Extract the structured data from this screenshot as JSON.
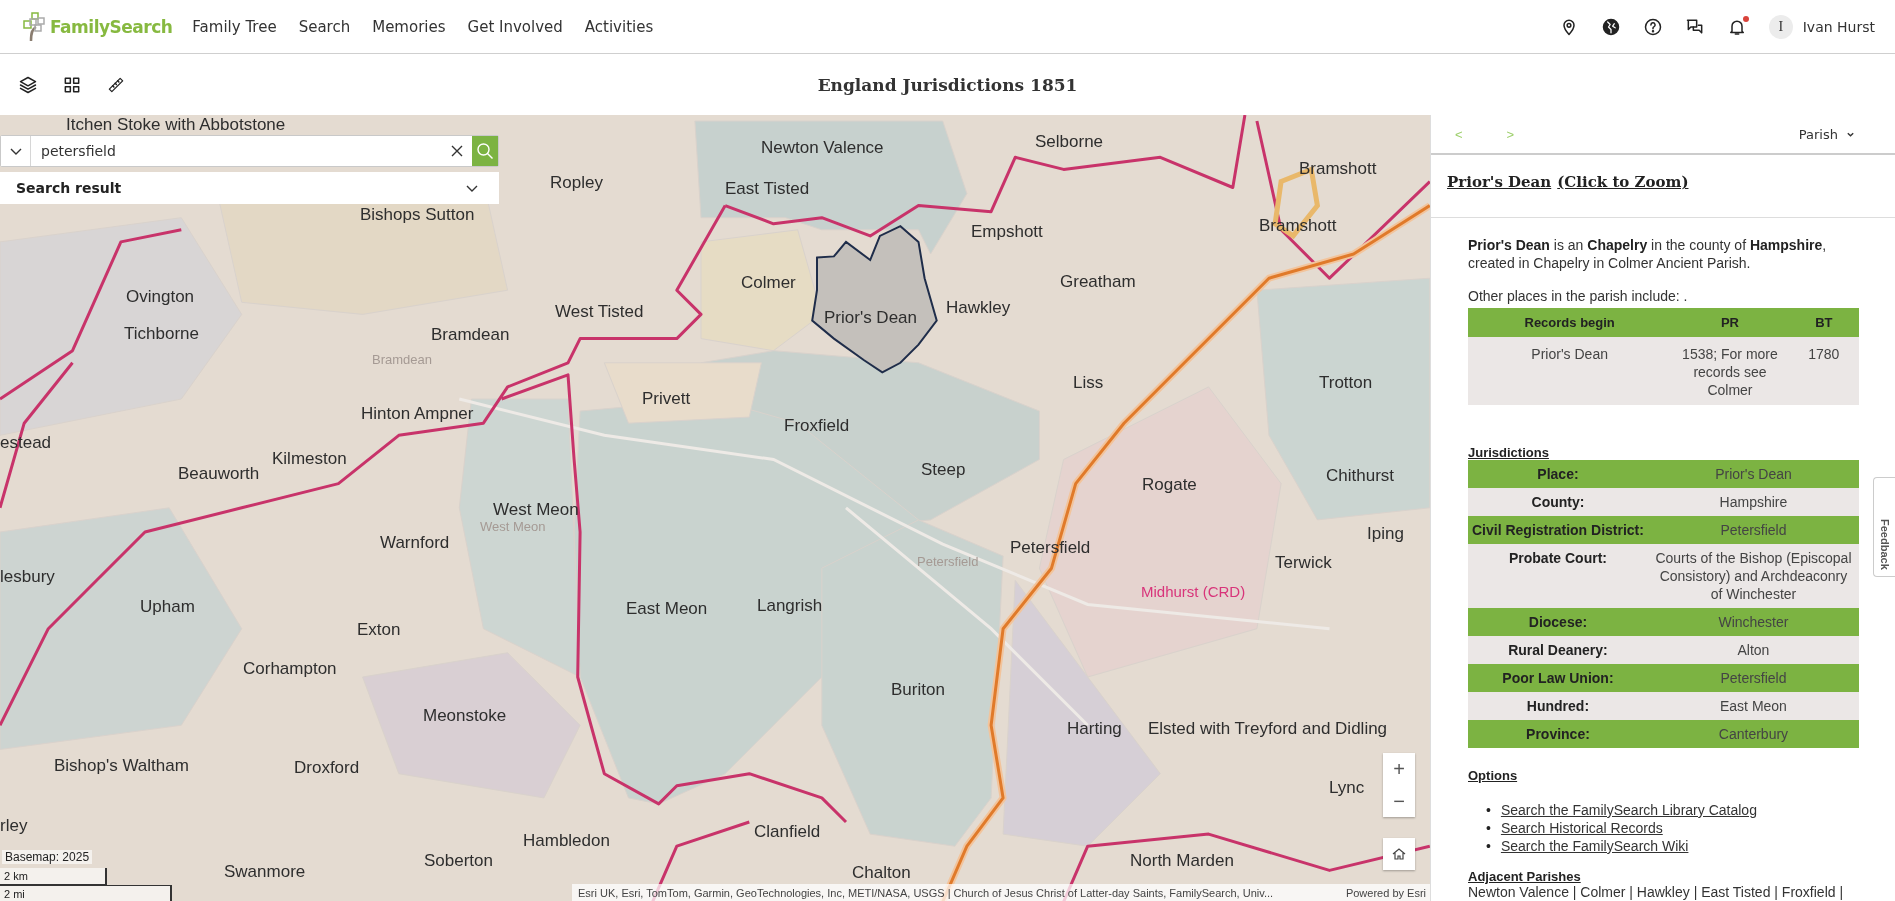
{
  "header": {
    "brand": "FamilySearch",
    "nav": [
      "Family Tree",
      "Search",
      "Memories",
      "Get Involved",
      "Activities"
    ],
    "notifications_unread": true,
    "user": {
      "initial": "I",
      "name": "Ivan Hurst"
    }
  },
  "toolbar": {
    "title": "England Jurisdictions 1851"
  },
  "search": {
    "value": "petersfield",
    "result_label": "Search result"
  },
  "map": {
    "labels": [
      {
        "text": "Itchen Stoke with Abbotstone",
        "kind": "place"
      },
      {
        "text": "Newton Valence",
        "kind": "place"
      },
      {
        "text": "Selborne",
        "kind": "place"
      },
      {
        "text": "Bramshott",
        "kind": "place"
      },
      {
        "text": "Ropley",
        "kind": "place"
      },
      {
        "text": "East Tisted",
        "kind": "place"
      },
      {
        "text": "Bishops Sutton",
        "kind": "place"
      },
      {
        "text": "Empshott",
        "kind": "place"
      },
      {
        "text": "Bramshott",
        "kind": "place"
      },
      {
        "text": "Colmer",
        "kind": "place"
      },
      {
        "text": "Greatham",
        "kind": "place"
      },
      {
        "text": "Ovington",
        "kind": "place"
      },
      {
        "text": "West Tisted",
        "kind": "place"
      },
      {
        "text": "Hawkley",
        "kind": "place"
      },
      {
        "text": "Prior's Dean",
        "kind": "place"
      },
      {
        "text": "Tichborne",
        "kind": "place"
      },
      {
        "text": "Bramdean",
        "kind": "place"
      },
      {
        "text": "Bramdean",
        "kind": "town"
      },
      {
        "text": "Liss",
        "kind": "place"
      },
      {
        "text": "Trotton",
        "kind": "place"
      },
      {
        "text": "Privett",
        "kind": "place"
      },
      {
        "text": "Hinton Ampner",
        "kind": "place"
      },
      {
        "text": "Froxfield",
        "kind": "place"
      },
      {
        "text": "estead",
        "kind": "place"
      },
      {
        "text": "Beauworth",
        "kind": "place"
      },
      {
        "text": "Kilmeston",
        "kind": "place"
      },
      {
        "text": "Steep",
        "kind": "place"
      },
      {
        "text": "Rogate",
        "kind": "place"
      },
      {
        "text": "Chithurst",
        "kind": "place"
      },
      {
        "text": "West Meon",
        "kind": "place"
      },
      {
        "text": "West Meon",
        "kind": "town"
      },
      {
        "text": "Warnford",
        "kind": "place"
      },
      {
        "text": "Petersfield",
        "kind": "place"
      },
      {
        "text": "Iping",
        "kind": "place"
      },
      {
        "text": "lesbury",
        "kind": "place"
      },
      {
        "text": "Petersfield",
        "kind": "town"
      },
      {
        "text": "Terwick",
        "kind": "place"
      },
      {
        "text": "Midhurst (CRD)",
        "kind": "district"
      },
      {
        "text": "Upham",
        "kind": "place"
      },
      {
        "text": "East Meon",
        "kind": "place"
      },
      {
        "text": "Langrish",
        "kind": "place"
      },
      {
        "text": "Exton",
        "kind": "place"
      },
      {
        "text": "Corhampton",
        "kind": "place"
      },
      {
        "text": "Buriton",
        "kind": "place"
      },
      {
        "text": "Meonstoke",
        "kind": "place"
      },
      {
        "text": "Harting",
        "kind": "place"
      },
      {
        "text": "Elsted with Treyford and Didling",
        "kind": "place"
      },
      {
        "text": "Bishop's Waltham",
        "kind": "place"
      },
      {
        "text": "Droxford",
        "kind": "place"
      },
      {
        "text": "Lync",
        "kind": "place"
      },
      {
        "text": "rley",
        "kind": "place"
      },
      {
        "text": "Hambledon",
        "kind": "place"
      },
      {
        "text": "Clanfield",
        "kind": "place"
      },
      {
        "text": "Swanmore",
        "kind": "place"
      },
      {
        "text": "Soberton",
        "kind": "place"
      },
      {
        "text": "Chalton",
        "kind": "place"
      },
      {
        "text": "North Marden",
        "kind": "place"
      }
    ],
    "zoom_in": "+",
    "zoom_out": "−",
    "basemap": "Basemap: 2025",
    "scale": [
      "2 km",
      "2 mi"
    ],
    "attribution": "Esri UK, Esri, TomTom, Garmin, GeoTechnologies, Inc, METI/NASA, USGS | Church of Jesus Christ of Latter-day Saints, FamilySearch, Univ...",
    "powered": "Powered by Esri"
  },
  "panel": {
    "prev": "<",
    "next": ">",
    "layer": "Parish",
    "title": "Prior's Dean",
    "zoom_link": "(Click to Zoom)",
    "description": "**Prior's Dean** is an **Chapelry** in the county of **Hampshire**, created in Chapelry in Colmer Ancient Parish.",
    "other_places": "Other places in the parish include: .",
    "records": {
      "columns": [
        "Records begin",
        "PR",
        "BT"
      ],
      "rows": [
        [
          "Prior's Dean",
          "1538; For more records see Colmer",
          "1780"
        ]
      ]
    },
    "jurisdictions_heading": "Jurisdictions",
    "jurisdictions": [
      {
        "label": "Place:",
        "value": "Prior's Dean"
      },
      {
        "label": "County:",
        "value": "Hampshire"
      },
      {
        "label": "Civil Registration District:",
        "value": "Petersfield"
      },
      {
        "label": "Probate Court:",
        "value": "Courts of the Bishop (Episcopal Consistory) and Archdeaconry of Winchester"
      },
      {
        "label": "Diocese:",
        "value": "Winchester"
      },
      {
        "label": "Rural Deanery:",
        "value": "Alton"
      },
      {
        "label": "Poor Law Union:",
        "value": "Petersfield"
      },
      {
        "label": "Hundred:",
        "value": "East Meon"
      },
      {
        "label": "Province:",
        "value": "Canterbury"
      }
    ],
    "options_heading": "Options",
    "options": [
      {
        "marker": "•",
        "text": "Search the FamilySearch Library Catalog"
      },
      {
        "marker": "•",
        "text": "Search Historical Records"
      },
      {
        "marker": "•",
        "text": "Search the FamilySearch Wiki"
      }
    ],
    "adjacent_heading": "Adjacent Parishes",
    "adjacent": "Newton Valence | Colmer | Hawkley | East Tisted | Froxfield |"
  },
  "feedback": "Feedback"
}
